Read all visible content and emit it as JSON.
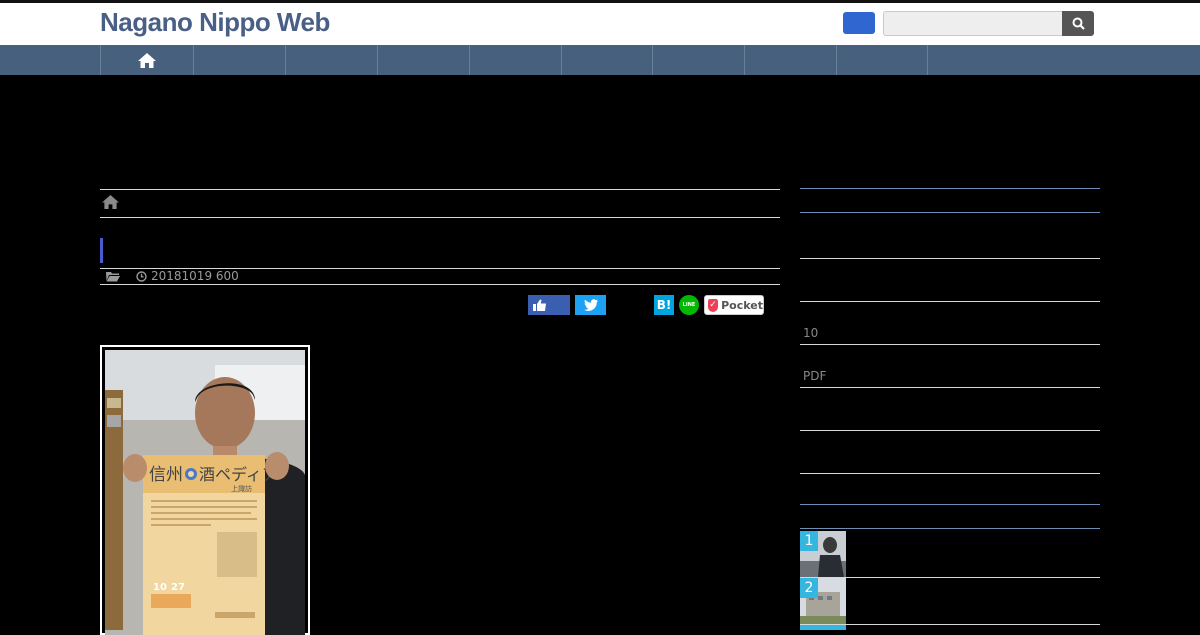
{
  "site": {
    "logo": "Nagano Nippo Web"
  },
  "nav": {
    "items": [
      "",
      "",
      "",
      "",
      "",
      "",
      "",
      ""
    ]
  },
  "article": {
    "meta_date": "20181019 600",
    "share": {
      "hatena": "B!",
      "line": "LINE",
      "pocket": "Pocket"
    },
    "photo": {
      "poster_title": "信州",
      "poster_title_2": "酒ペディア",
      "poster_sub": "上諏訪",
      "poster_date_month": "10",
      "poster_date_day": "27"
    }
  },
  "sidebar": {
    "texts": [
      "10",
      "PDF"
    ],
    "ranking": [
      "1",
      "2"
    ]
  },
  "colors": {
    "nav": "#47607e",
    "logo": "#4a5f86",
    "accent": "#35b6e0"
  }
}
